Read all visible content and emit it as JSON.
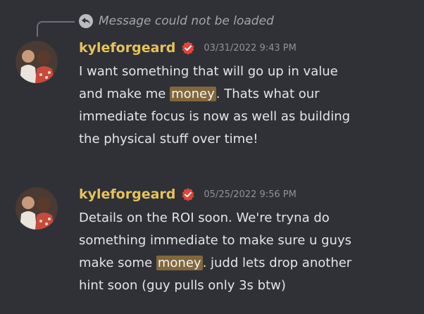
{
  "reply": {
    "text": "Message could not be loaded",
    "icon": "reply-arrow-icon"
  },
  "messages": [
    {
      "username": "kyleforgeard",
      "timestamp": "03/31/2022 9:43 PM",
      "lines": [
        {
          "pre": "I want something that will go up in value",
          "hl": "",
          "post": ""
        },
        {
          "pre": "and make me ",
          "hl": "money",
          "post": ". Thats what our"
        },
        {
          "pre": "immediate focus is now as well as building",
          "hl": "",
          "post": ""
        },
        {
          "pre": "the physical stuff over time!",
          "hl": "",
          "post": ""
        }
      ]
    },
    {
      "username": "kyleforgeard",
      "timestamp": "05/25/2022 9:56 PM",
      "lines": [
        {
          "pre": "Details on the ROI soon. We're tryna do",
          "hl": "",
          "post": ""
        },
        {
          "pre": "something immediate to make sure u guys",
          "hl": "",
          "post": ""
        },
        {
          "pre": "make some ",
          "hl": "money",
          "post": ". judd lets drop another"
        },
        {
          "pre": "hint soon (guy pulls only 3s btw)",
          "hl": "",
          "post": ""
        }
      ]
    }
  ],
  "colors": {
    "background": "#2f3136",
    "username": "#e8c25a",
    "badge": "#e0443a",
    "highlight": "#b48a3f"
  }
}
